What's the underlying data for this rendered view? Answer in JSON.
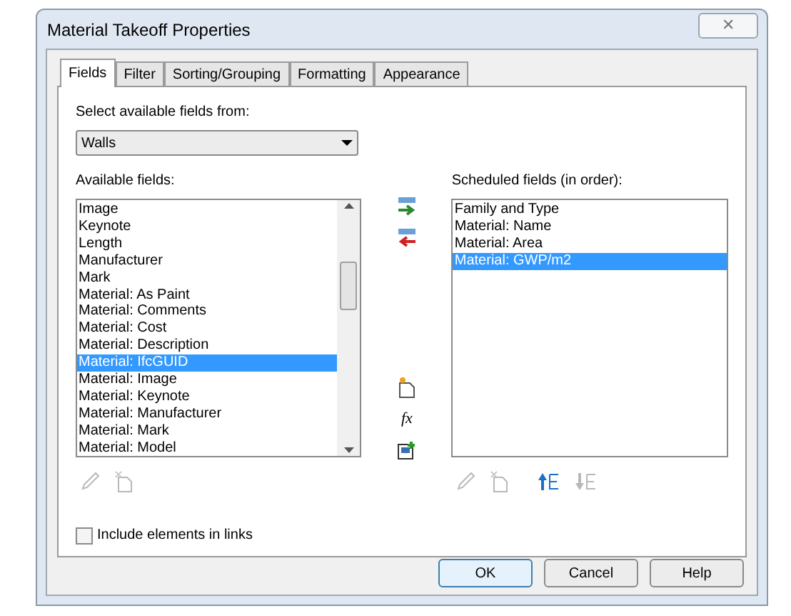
{
  "window": {
    "title": "Material Takeoff Properties",
    "close": "✕"
  },
  "tabs": [
    {
      "label": "Fields",
      "selected": true
    },
    {
      "label": "Filter",
      "selected": false
    },
    {
      "label": "Sorting/Grouping",
      "selected": false
    },
    {
      "label": "Formatting",
      "selected": false
    },
    {
      "label": "Appearance",
      "selected": false
    }
  ],
  "source": {
    "label": "Select available fields from:",
    "value": "Walls"
  },
  "available": {
    "label": "Available fields:",
    "items": [
      {
        "label": "Image",
        "selected": false
      },
      {
        "label": "Keynote",
        "selected": false
      },
      {
        "label": "Length",
        "selected": false
      },
      {
        "label": "Manufacturer",
        "selected": false
      },
      {
        "label": "Mark",
        "selected": false
      },
      {
        "label": "Material: As Paint",
        "selected": false
      },
      {
        "label": "Material: Comments",
        "selected": false
      },
      {
        "label": "Material: Cost",
        "selected": false
      },
      {
        "label": "Material: Description",
        "selected": false
      },
      {
        "label": "Material: IfcGUID",
        "selected": true
      },
      {
        "label": "Material: Image",
        "selected": false
      },
      {
        "label": "Material: Keynote",
        "selected": false
      },
      {
        "label": "Material: Manufacturer",
        "selected": false
      },
      {
        "label": "Material: Mark",
        "selected": false
      },
      {
        "label": "Material: Model",
        "selected": false
      }
    ]
  },
  "scheduled": {
    "label": "Scheduled fields (in order):",
    "items": [
      {
        "label": "Family and Type",
        "selected": false
      },
      {
        "label": "Material: Name",
        "selected": false
      },
      {
        "label": "Material: Area",
        "selected": false
      },
      {
        "label": "Material: GWP/m2",
        "selected": true
      }
    ]
  },
  "left_tools": [
    {
      "kind": "edit",
      "disabled": true
    },
    {
      "kind": "delete",
      "disabled": true
    }
  ],
  "right_tools": [
    {
      "kind": "edit",
      "disabled": true
    },
    {
      "kind": "delete",
      "disabled": true
    },
    {
      "kind": "up",
      "disabled": false
    },
    {
      "kind": "down",
      "disabled": true
    }
  ],
  "formula": {
    "label": "fx"
  },
  "include_links": {
    "label": "Include elements in links",
    "checked": false
  },
  "buttons": [
    {
      "label": "OK",
      "default": true
    },
    {
      "label": "Cancel",
      "default": false
    },
    {
      "label": "Help",
      "default": false
    }
  ]
}
